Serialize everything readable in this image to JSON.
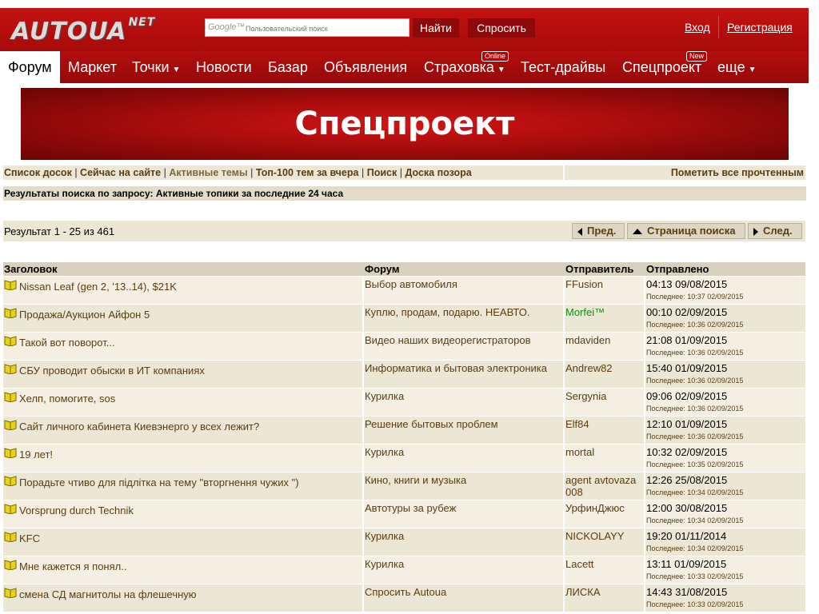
{
  "header": {
    "logo_text": "AUTOUA",
    "logo_suffix": "NET",
    "search_google": "Google™",
    "search_placeholder": "Пользовательский поиск",
    "find_label": "Найти",
    "ask_label": "Спросить",
    "login_label": "Вход",
    "register_label": "Регистрация"
  },
  "nav": {
    "items": [
      {
        "label": "Форум",
        "active": true
      },
      {
        "label": "Маркет"
      },
      {
        "label": "Точки",
        "dropdown": true
      },
      {
        "label": "Новости"
      },
      {
        "label": "Базар"
      },
      {
        "label": "Объявления"
      },
      {
        "label": "Страховка",
        "dropdown": true,
        "badge": "Online"
      },
      {
        "label": "Тест-драйвы"
      },
      {
        "label": "Спецпроект",
        "badge": "New"
      },
      {
        "label": "еще",
        "dropdown": true
      }
    ]
  },
  "banner": {
    "title": "Спецпроект"
  },
  "forum_nav": {
    "links": [
      "Список досок",
      "Сейчас на сайте",
      "Активные темы",
      "Топ-100 тем за вчера",
      "Поиск",
      "Доска позора"
    ],
    "mark_read": "Пометить все прочтенным"
  },
  "search_title": "Результаты поиска по запросу: Активные топики за последние 24 часа",
  "results": {
    "count_text": "Результат 1 - 25 из 461",
    "prev_label": "Пред.",
    "page_label": "Страница поиска",
    "next_label": "След."
  },
  "table": {
    "headers": [
      "Заголовок",
      "Форум",
      "Отправитель",
      "Отправлено"
    ],
    "last_prefix": "Последнее:",
    "rows": [
      {
        "title": "Nissan Leaf (gen 2, '13..14), $21K",
        "forum": "Выбор автомобиля",
        "sender": "FFusion",
        "sent": "04:13 09/08/2015",
        "last": "Последнее: 10:37 02/09/2015"
      },
      {
        "title": "Продажа/Аукцион Айфон 5",
        "forum": "Куплю, продам, подарю. НЕАВТО.",
        "sender": "Morfei™",
        "sender_green": true,
        "sent": "00:10 02/09/2015",
        "last": "Последнее: 10:36 02/09/2015"
      },
      {
        "title": "Такой вот поворот...",
        "forum": "Видео наших видеорегистраторов",
        "sender": "mdaviden",
        "sent": "21:08 01/09/2015",
        "last": "Последнее: 10:36 02/09/2015"
      },
      {
        "title": "СБУ проводит обыски в ИТ компаниях",
        "forum": "Информатика и бытовая электроника",
        "sender": "Andrew82",
        "sent": "15:40 01/09/2015",
        "last": "Последнее: 10:36 02/09/2015"
      },
      {
        "title": "Хелп, помогите, sos",
        "forum": "Курилка",
        "sender": "Sergynia",
        "sent": "09:06 02/09/2015",
        "last": "Последнее: 10:36 02/09/2015"
      },
      {
        "title": "Сайт личного кабинета Киевэнерго у всех лежит?",
        "forum": "Решение бытовых проблем",
        "sender": "Elf84",
        "sent": "12:10 01/09/2015",
        "last": "Последнее: 10:36 02/09/2015"
      },
      {
        "title": "19 лет!",
        "forum": "Курилка",
        "sender": "mortal",
        "sent": "10:32 02/09/2015",
        "last": "Последнее: 10:35 02/09/2015"
      },
      {
        "title": "Порадьте чтиво для підлітка на тему \"вторгнення чужих \")",
        "forum": "Кино, книги и музыка",
        "sender": "agent avtovaza 008",
        "sent": "12:26 25/08/2015",
        "last": "Последнее: 10:34 02/09/2015"
      },
      {
        "title": "Vorsprung durch Technik",
        "forum": "Автотуры за рубеж",
        "sender": "УрфинДжюс",
        "sent": "12:00 30/08/2015",
        "last": "Последнее: 10:34 02/09/2015"
      },
      {
        "title": "KFC",
        "forum": "Курилка",
        "sender": "NICKOLAYY",
        "sent": "19:20 01/11/2014",
        "last": "Последнее: 10:34 02/09/2015"
      },
      {
        "title": "Мне кажется я понял..",
        "forum": "Курилка",
        "sender": "Lacett",
        "sent": "13:11 01/09/2015",
        "last": "Последнее: 10:33 02/09/2015"
      },
      {
        "title": "смена СД магнитолы на флешечную",
        "forum": "Спросить Autoua",
        "sender": "ЛИСКА",
        "sent": "14:43 31/08/2015",
        "last": "Последнее: 10:33 02/09/2015"
      }
    ]
  }
}
